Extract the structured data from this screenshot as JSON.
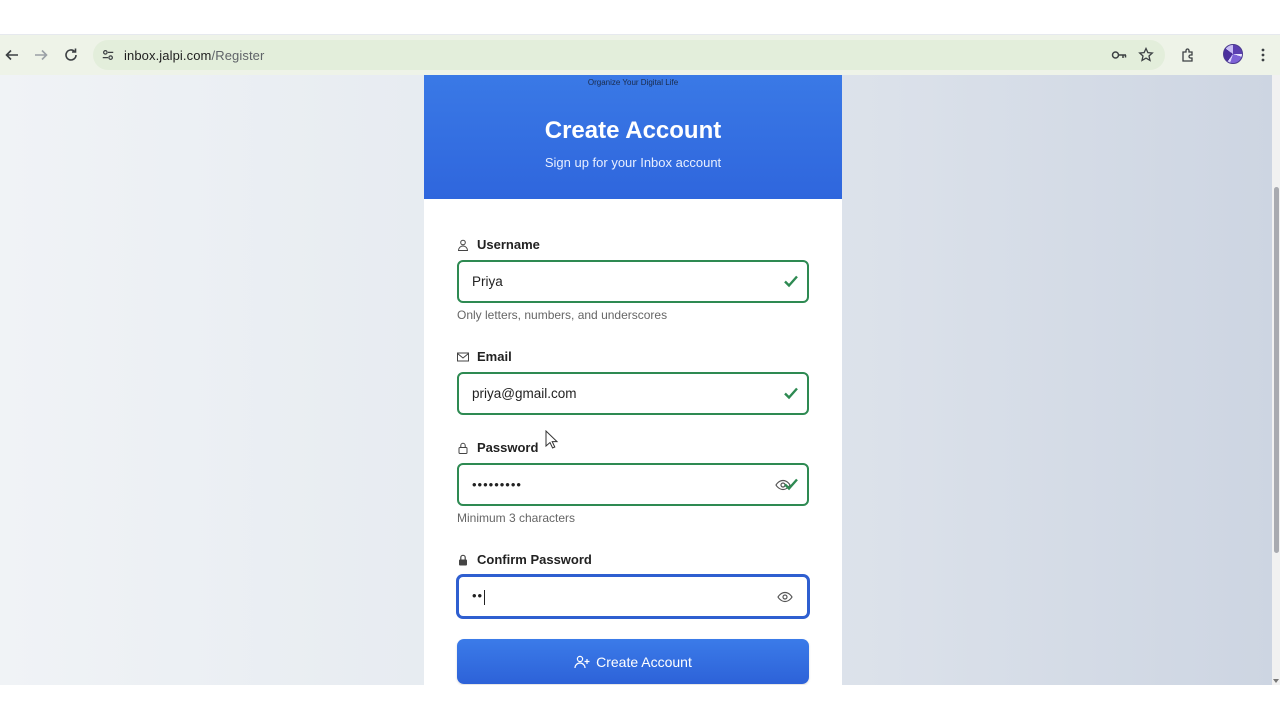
{
  "browser": {
    "url_domain": "inbox.jalpi.com",
    "url_path": "/Register",
    "icons": [
      "back-icon",
      "forward-icon",
      "reload-icon",
      "site-settings-icon",
      "password-key-icon",
      "bookmark-star-icon",
      "extensions-icon",
      "profile-avatar",
      "kebab-menu-icon"
    ]
  },
  "header": {
    "tagline": "Organize Your Digital Life",
    "title": "Create Account",
    "subtitle": "Sign up for your Inbox account"
  },
  "form": {
    "username": {
      "label": "Username",
      "value": "Priya",
      "hint": "Only letters, numbers, and underscores",
      "valid": true
    },
    "email": {
      "label": "Email",
      "value": "priya@gmail.com",
      "valid": true
    },
    "password": {
      "label": "Password",
      "value_masked": "•••••••••",
      "hint": "Minimum 3 characters",
      "valid": true
    },
    "confirm_password": {
      "label": "Confirm Password",
      "value_masked": "••",
      "focused": true
    },
    "submit_label": "Create Account"
  },
  "colors": {
    "header_blue": "#3a79e6",
    "valid_green": "#2e8a52",
    "focus_blue": "#2f5fd0",
    "button_blue": "#3b7be9"
  }
}
